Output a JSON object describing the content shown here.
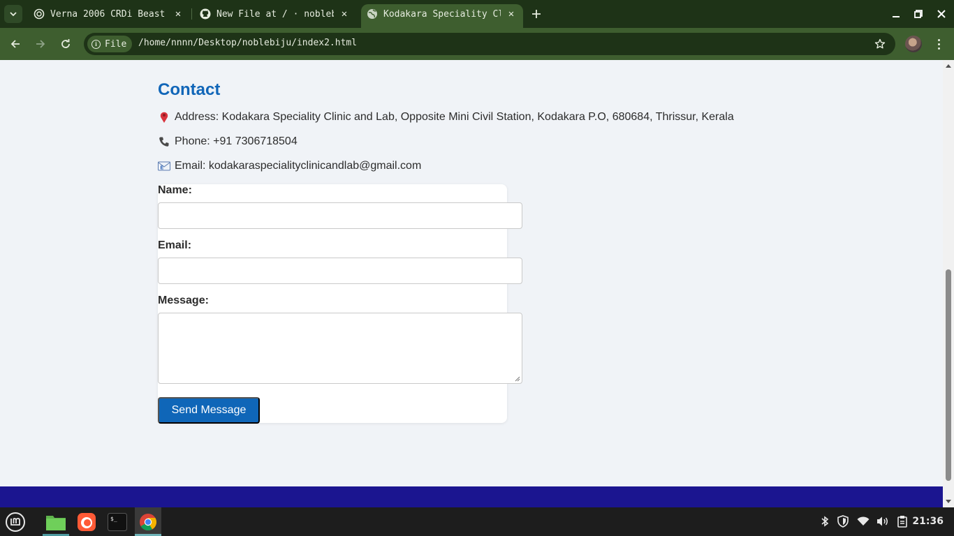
{
  "browser": {
    "tabs": [
      {
        "title": "Verna 2006 CRDi Beast",
        "icon": "openai-icon"
      },
      {
        "title": "New File at / · noblebiju",
        "icon": "github-icon"
      },
      {
        "title": "Kodakara Speciality Clinic",
        "icon": "globe-icon",
        "active": true
      }
    ],
    "address_chip": "File",
    "url": "/home/nnnn/Desktop/noblebiju/index2.html"
  },
  "page": {
    "contact_heading": "Contact",
    "address": {
      "icon": "📍",
      "text": "Address: Kodakara Speciality Clinic and Lab, Opposite Mini Civil Station, Kodakara P.O, 680684, Thrissur, Kerala"
    },
    "phone": {
      "icon": "📞",
      "text": "Phone: +91 7306718504"
    },
    "email": {
      "icon": "📧",
      "text": "Email: kodakaraspecialityclinicandlab@gmail.com"
    },
    "form": {
      "name_label": "Name:",
      "name_value": "",
      "email_label": "Email:",
      "email_value": "",
      "message_label": "Message:",
      "message_value": "",
      "submit_label": "Send Message"
    },
    "colors": {
      "heading": "#1166b8",
      "button": "#0f66b8",
      "footer": "#1b1590",
      "background": "#f0f3f7"
    }
  },
  "taskbar": {
    "items": [
      "mint-menu-icon",
      "files-icon",
      "firefox-icon",
      "terminal-icon",
      "chrome-icon"
    ],
    "terminal_glyph": "$_",
    "tray": [
      "bluetooth-icon",
      "shield-icon",
      "wifi-icon",
      "volume-icon",
      "clipboard-icon"
    ],
    "clock": "21:36"
  }
}
